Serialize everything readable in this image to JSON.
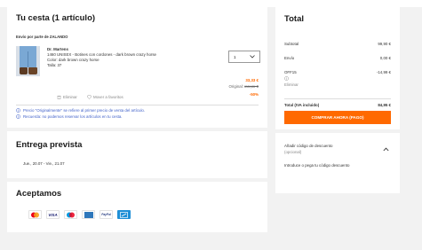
{
  "cart": {
    "title": "Tu cesta (1 artículo)",
    "shipper": "Envío por parte de ZALANDO",
    "item": {
      "brand": "Dr. Martens",
      "name": "1460 UNISEX - Botines con cordones - dark brown crazy horse",
      "color": "Color: dark brown crazy horse",
      "size": "Talla: 37",
      "price": "33,33 €",
      "original_label": "Original:",
      "original_price": "xxx,xx €",
      "discount": "-50%",
      "quantity": "1",
      "remove_label": "Eliminar",
      "favorites_label": "Mover a favoritos"
    },
    "notes": [
      "Precio \"Originalmente\" se refiere al primer precio de venta del artículo.",
      "Recuerda: no podemos reservar los artículos en tu cesta."
    ]
  },
  "delivery": {
    "title": "Entrega prevista",
    "dates": "Jue., 20.07 - Vie., 21.07"
  },
  "payments": {
    "title": "Aceptamos",
    "methods": [
      "mastercard",
      "visa",
      "maestro",
      "amex",
      "paypal",
      "gift-card"
    ],
    "labels": {
      "visa": "VISA",
      "paypal": "PayPal"
    }
  },
  "summary": {
    "title": "Total",
    "subtotal_label": "Subtotal",
    "subtotal_value": "99,90 €",
    "shipping_label": "Envío",
    "shipping_value": "0,00 €",
    "offer_label": "OFF15",
    "offer_value": "-14,99 €",
    "offer_remove": "Eliminar",
    "total_label": "Total (IVA incluido)",
    "total_value": "84,95 €",
    "checkout_button": "COMPRAR AHORA (PAGO)"
  },
  "discount_code": {
    "title": "Añadir código de descuento",
    "subtitle": "(opcional)",
    "placeholder": "Introduce o pega tu código descuento"
  },
  "colors": {
    "accent": "#ff6900",
    "background": "#f2f2f2",
    "card": "#ffffff"
  }
}
